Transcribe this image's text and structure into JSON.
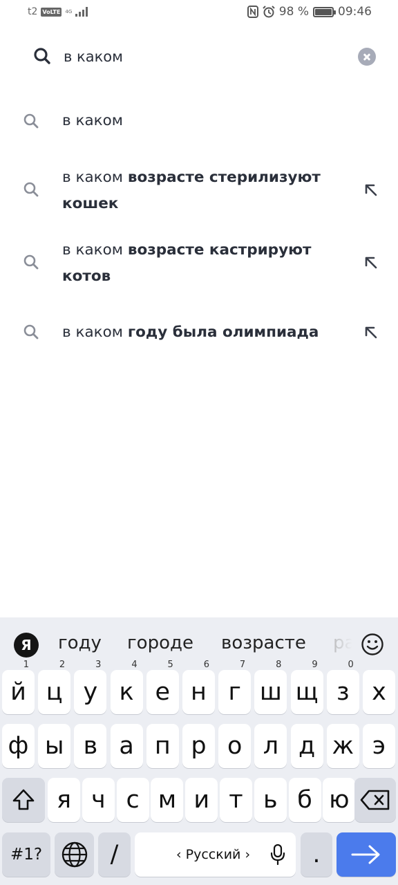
{
  "status_bar": {
    "carrier": "t2",
    "volte": "VoLTE",
    "network": "4G",
    "battery": "98 %",
    "battery_level": 0.98,
    "time": "09:46"
  },
  "search": {
    "query": "в каком",
    "icon": "search-icon",
    "clear_icon": "clear-icon"
  },
  "suggestions": [
    {
      "plain": "в каком",
      "bold": "",
      "has_arrow": false
    },
    {
      "plain": "в каком ",
      "bold": "возрасте стерилизуют кошек",
      "has_arrow": true
    },
    {
      "plain": "в каком ",
      "bold": "возрасте кастрируют котов",
      "has_arrow": true
    },
    {
      "plain": "в каком ",
      "bold": "году была олимпиада",
      "has_arrow": true
    }
  ],
  "keyboard": {
    "logo": "Я",
    "word_suggestions": [
      "году",
      "городе",
      "возрасте",
      "ра"
    ],
    "row1": [
      "й",
      "ц",
      "у",
      "к",
      "е",
      "н",
      "г",
      "ш",
      "щ",
      "з",
      "х"
    ],
    "row1_hints": [
      "1",
      "2",
      "3",
      "4",
      "5",
      "6",
      "7",
      "8",
      "9",
      "0",
      ""
    ],
    "row2": [
      "ф",
      "ы",
      "в",
      "а",
      "п",
      "р",
      "о",
      "л",
      "д",
      "ж",
      "э"
    ],
    "row3": [
      "я",
      "ч",
      "с",
      "м",
      "и",
      "т",
      "ь",
      "б",
      "ю"
    ],
    "symbols_label": "#1?",
    "slash_label": "/",
    "language_label": "‹ Русский ›",
    "period_label": "."
  }
}
